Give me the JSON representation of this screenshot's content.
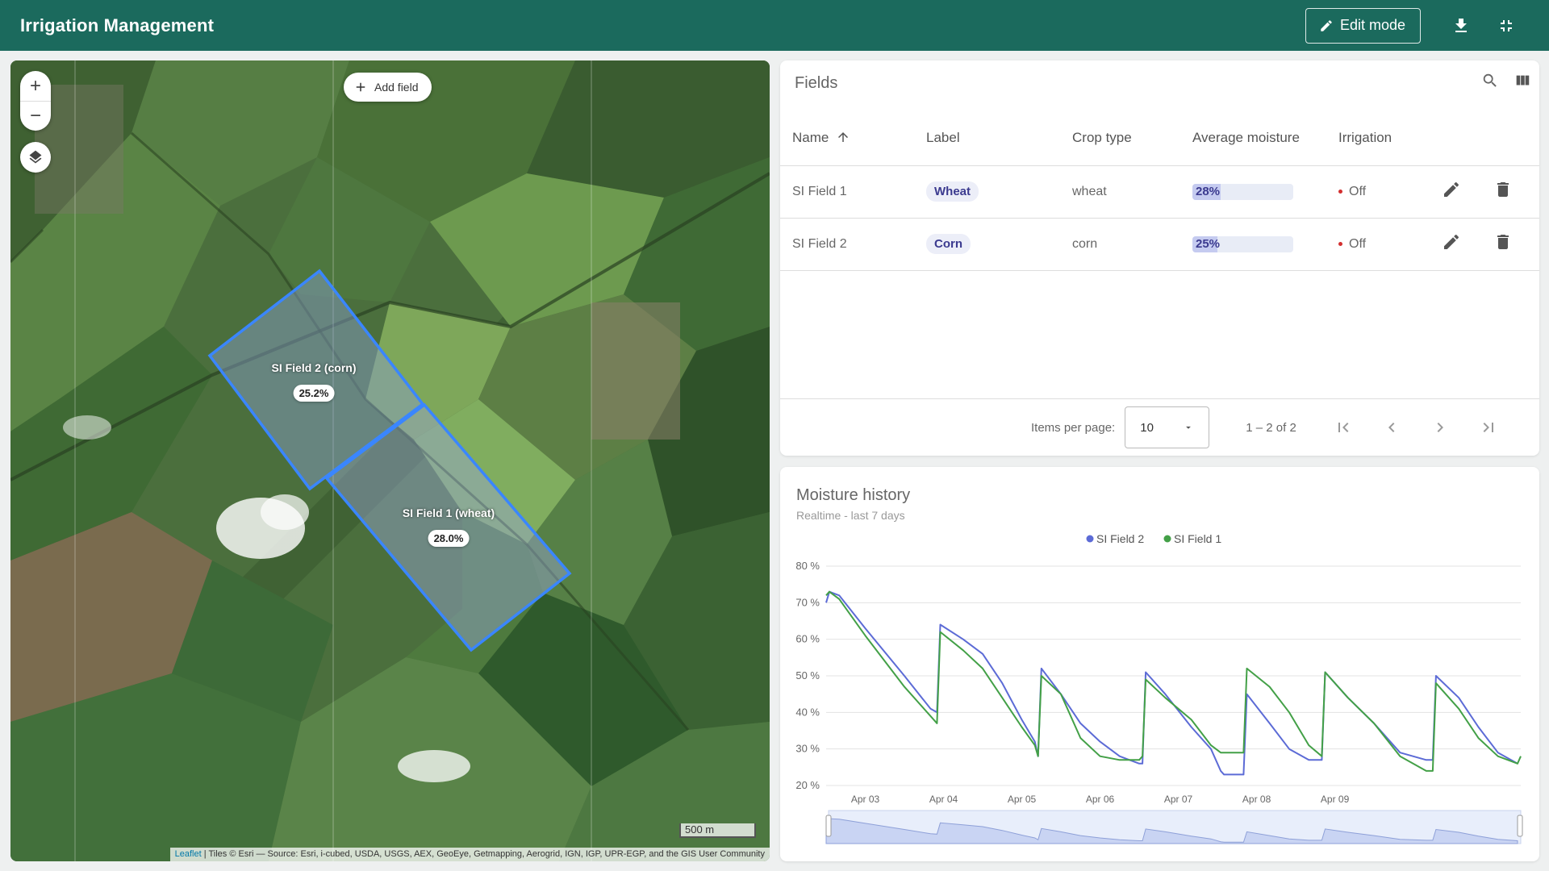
{
  "header": {
    "title": "Irrigation Management",
    "edit_label": "Edit mode",
    "icons": [
      "pencil-icon",
      "download-icon",
      "exit-fullscreen-icon"
    ]
  },
  "map": {
    "add_field_label": "Add field",
    "zoom_in": "+",
    "zoom_out": "−",
    "scale_label": "500 m",
    "attribution_leaflet": "Leaflet",
    "attribution_text": " | Tiles © Esri — Source: Esri, i-cubed, USDA, USGS, AEX, GeoEye, Getmapping, Aerogrid, IGN, IGP, UPR-EGP, and the GIS User Community",
    "fields": [
      {
        "label": "SI Field 2 (corn)",
        "value": "25.2%"
      },
      {
        "label": "SI Field 1 (wheat)",
        "value": "28.0%"
      }
    ]
  },
  "fields_table": {
    "title": "Fields",
    "columns": [
      "Name",
      "Label",
      "Crop type",
      "Average moisture",
      "Irrigation"
    ],
    "sort_column": "Name",
    "rows": [
      {
        "name": "SI Field 1",
        "label": "Wheat",
        "crop": "wheat",
        "moisture": "28%",
        "moisture_value": 0.28,
        "irrigation": "Off"
      },
      {
        "name": "SI Field 2",
        "label": "Corn",
        "crop": "corn",
        "moisture": "25%",
        "moisture_value": 0.25,
        "irrigation": "Off"
      }
    ],
    "paginator": {
      "items_per_page_label": "Items per page:",
      "items_per_page_value": "10",
      "range_label": "1 – 2 of 2"
    }
  },
  "moisture_chart": {
    "title": "Moisture history",
    "subtitle": "Realtime - last 7 days"
  },
  "chart_data": {
    "type": "line",
    "title": "Moisture history",
    "subtitle": "Realtime - last 7 days",
    "legend_position": "top-center",
    "ylim": [
      20,
      80
    ],
    "y_ticks": [
      "20 %",
      "30 %",
      "40 %",
      "50 %",
      "60 %",
      "70 %",
      "80 %"
    ],
    "x_ticks": [
      "Apr 03",
      "Apr 04",
      "Apr 05",
      "Apr 06",
      "Apr 07",
      "Apr 08",
      "Apr 09"
    ],
    "x_range": [
      "Apr 02 12:00",
      "Apr 09 18:00"
    ],
    "series": [
      {
        "name": "SI Field 2",
        "color": "#5c6bd6",
        "points": [
          [
            "Apr 02 12:00",
            70
          ],
          [
            "Apr 02 13:00",
            73
          ],
          [
            "Apr 02 16:00",
            72
          ],
          [
            "Apr 03 00:00",
            63
          ],
          [
            "Apr 03 12:00",
            50
          ],
          [
            "Apr 03 20:00",
            41
          ],
          [
            "Apr 03 22:00",
            40
          ],
          [
            "Apr 03 23:00",
            64
          ],
          [
            "Apr 04 06:00",
            60
          ],
          [
            "Apr 04 12:00",
            56
          ],
          [
            "Apr 04 18:00",
            48
          ],
          [
            "Apr 05 00:00",
            38
          ],
          [
            "Apr 05 04:00",
            32
          ],
          [
            "Apr 05 05:00",
            28
          ],
          [
            "Apr 05 06:00",
            52
          ],
          [
            "Apr 05 12:00",
            45
          ],
          [
            "Apr 05 18:00",
            37
          ],
          [
            "Apr 06 00:00",
            32
          ],
          [
            "Apr 06 06:00",
            28
          ],
          [
            "Apr 06 12:00",
            26
          ],
          [
            "Apr 06 13:00",
            26
          ],
          [
            "Apr 06 14:00",
            51
          ],
          [
            "Apr 06 20:00",
            45
          ],
          [
            "Apr 07 04:00",
            36
          ],
          [
            "Apr 07 10:00",
            30
          ],
          [
            "Apr 07 13:00",
            24
          ],
          [
            "Apr 07 14:00",
            23
          ],
          [
            "Apr 07 20:00",
            23
          ],
          [
            "Apr 07 21:00",
            45
          ],
          [
            "Apr 08 04:00",
            37
          ],
          [
            "Apr 08 10:00",
            30
          ],
          [
            "Apr 08 16:00",
            27
          ],
          [
            "Apr 08 20:00",
            27
          ],
          [
            "Apr 08 21:00",
            51
          ],
          [
            "Apr 09 04:00",
            44
          ],
          [
            "Apr 09 12:00",
            37
          ],
          [
            "Apr 09 20:00",
            29
          ],
          [
            "Apr 10 04:00",
            27
          ],
          [
            "Apr 10 06:00",
            27
          ],
          [
            "Apr 10 07:00",
            50
          ],
          [
            "Apr 10 14:00",
            44
          ],
          [
            "Apr 10 20:00",
            36
          ],
          [
            "Apr 11 02:00",
            29
          ],
          [
            "Apr 11 08:00",
            26
          ]
        ]
      },
      {
        "name": "SI Field 1",
        "color": "#43a047",
        "points": [
          [
            "Apr 02 12:00",
            72
          ],
          [
            "Apr 02 13:00",
            73
          ],
          [
            "Apr 02 16:00",
            71
          ],
          [
            "Apr 03 00:00",
            61
          ],
          [
            "Apr 03 12:00",
            47
          ],
          [
            "Apr 03 20:00",
            39
          ],
          [
            "Apr 03 22:00",
            37
          ],
          [
            "Apr 03 23:00",
            62
          ],
          [
            "Apr 04 06:00",
            57
          ],
          [
            "Apr 04 12:00",
            52
          ],
          [
            "Apr 04 18:00",
            44
          ],
          [
            "Apr 05 00:00",
            36
          ],
          [
            "Apr 05 04:00",
            31
          ],
          [
            "Apr 05 05:00",
            28
          ],
          [
            "Apr 05 06:00",
            50
          ],
          [
            "Apr 05 12:00",
            45
          ],
          [
            "Apr 05 18:00",
            33
          ],
          [
            "Apr 06 00:00",
            28
          ],
          [
            "Apr 06 06:00",
            27
          ],
          [
            "Apr 06 12:00",
            27
          ],
          [
            "Apr 06 13:00",
            28
          ],
          [
            "Apr 06 14:00",
            49
          ],
          [
            "Apr 06 20:00",
            44
          ],
          [
            "Apr 07 04:00",
            38
          ],
          [
            "Apr 07 10:00",
            31
          ],
          [
            "Apr 07 13:00",
            29
          ],
          [
            "Apr 07 14:00",
            29
          ],
          [
            "Apr 07 20:00",
            29
          ],
          [
            "Apr 07 21:00",
            52
          ],
          [
            "Apr 08 04:00",
            47
          ],
          [
            "Apr 08 10:00",
            40
          ],
          [
            "Apr 08 16:00",
            31
          ],
          [
            "Apr 08 20:00",
            28
          ],
          [
            "Apr 08 21:00",
            51
          ],
          [
            "Apr 09 04:00",
            44
          ],
          [
            "Apr 09 12:00",
            37
          ],
          [
            "Apr 09 20:00",
            28
          ],
          [
            "Apr 10 04:00",
            24
          ],
          [
            "Apr 10 06:00",
            24
          ],
          [
            "Apr 10 07:00",
            48
          ],
          [
            "Apr 10 14:00",
            41
          ],
          [
            "Apr 10 20:00",
            33
          ],
          [
            "Apr 11 02:00",
            28
          ],
          [
            "Apr 11 08:00",
            26
          ],
          [
            "Apr 11 09:00",
            28
          ]
        ]
      }
    ],
    "navigator": true
  }
}
